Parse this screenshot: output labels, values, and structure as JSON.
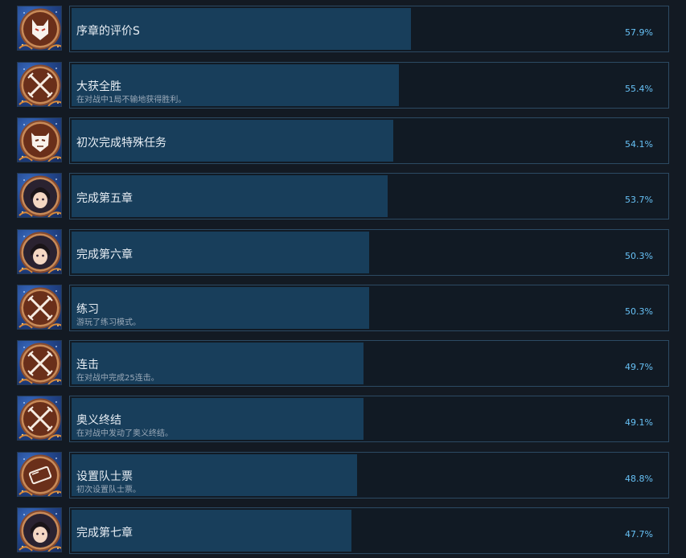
{
  "achievements": [
    {
      "title": "序章的评价S",
      "desc": "",
      "percent": "57.9%",
      "fill": 0.569,
      "icon": "fox-mask-icon"
    },
    {
      "title": "大获全胜",
      "desc": "在对战中1局不输地获得胜利。",
      "percent": "55.4%",
      "fill": 0.549,
      "icon": "crossed-swords-icon"
    },
    {
      "title": "初次完成特殊任务",
      "desc": "",
      "percent": "54.1%",
      "fill": 0.539,
      "icon": "oni-mask-icon"
    },
    {
      "title": "完成第五章",
      "desc": "",
      "percent": "53.7%",
      "fill": 0.529,
      "icon": "character-portrait-icon"
    },
    {
      "title": "完成第六章",
      "desc": "",
      "percent": "50.3%",
      "fill": 0.499,
      "icon": "character-portrait-icon"
    },
    {
      "title": "练习",
      "desc": "游玩了练习模式。",
      "percent": "50.3%",
      "fill": 0.499,
      "icon": "crossed-swords-icon"
    },
    {
      "title": "连击",
      "desc": "在对战中完成25连击。",
      "percent": "49.7%",
      "fill": 0.489,
      "icon": "crossed-swords-icon"
    },
    {
      "title": "奥义终结",
      "desc": "在对战中发动了奥义终结。",
      "percent": "49.1%",
      "fill": 0.489,
      "icon": "crossed-swords-icon"
    },
    {
      "title": "设置队士票",
      "desc": "初次设置队士票。",
      "percent": "48.8%",
      "fill": 0.479,
      "icon": "ticket-icon"
    },
    {
      "title": "完成第七章",
      "desc": "",
      "percent": "47.7%",
      "fill": 0.469,
      "icon": "character-portrait-icon"
    }
  ],
  "colors": {
    "background": "#131a23",
    "bar_fill": "#183e5b",
    "bar_border": "#2c4a63",
    "percent_text": "#67c1f5",
    "title_text": "#e8eef4",
    "desc_text": "#9aa9b8"
  }
}
